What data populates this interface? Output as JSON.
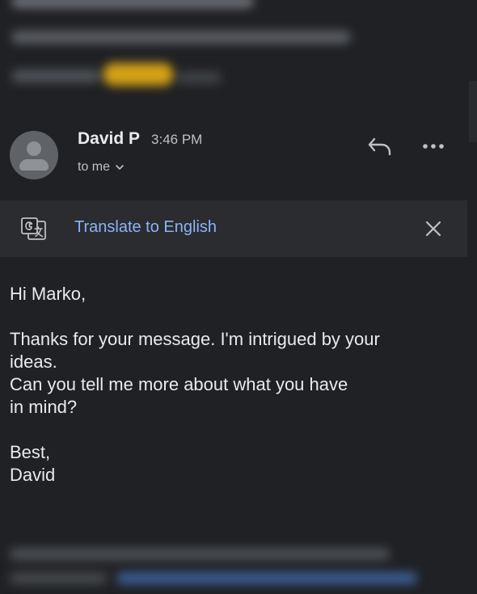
{
  "message": {
    "sender": "David P",
    "time": "3:46 PM",
    "recipient_label": "to me"
  },
  "actions": {
    "reply_icon": "reply-icon",
    "more_icon": "more-options-icon"
  },
  "translate_bar": {
    "icon": "google-translate-icon",
    "link_label": "Translate to English",
    "close_icon": "close-icon"
  },
  "body": {
    "greeting": "Hi Marko,",
    "paragraph_line1": "Thanks for your message. I'm intrigued by your",
    "paragraph_line2": "ideas.",
    "paragraph_line3": "Can you tell me more about what you have",
    "paragraph_line4": "in mind?",
    "signoff": "Best,",
    "signature": "David"
  },
  "colors": {
    "background": "#202124",
    "link": "#8ab4f8",
    "translate_bar": "#2b2c2f"
  }
}
